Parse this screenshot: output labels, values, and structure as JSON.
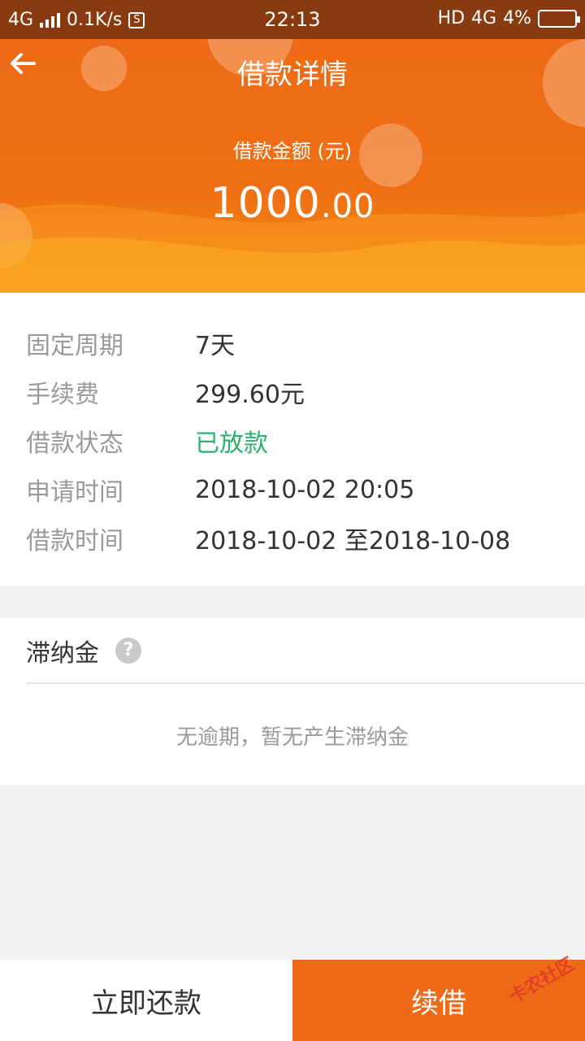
{
  "status_bar": {
    "network": "4G",
    "speed": "0.1K/s",
    "sim_badge": "S",
    "time": "22:13",
    "hd": "HD",
    "network2": "4G",
    "battery": "4%"
  },
  "header": {
    "title": "借款详情",
    "amount_label": "借款金额 (元)",
    "amount_int": "1000",
    "amount_dec": ".00"
  },
  "details": [
    {
      "key": "固定周期",
      "value": "7天"
    },
    {
      "key": "手续费",
      "value": "299.60元"
    },
    {
      "key": "借款状态",
      "value": "已放款"
    },
    {
      "key": "申请时间",
      "value": "2018-10-02 20:05"
    },
    {
      "key": "借款时间",
      "value": "2018-10-02 至2018-10-08"
    }
  ],
  "late_fee": {
    "title": "滞纳金",
    "help_glyph": "?",
    "empty_text": "无逾期，暂无产生滞纳金"
  },
  "actions": {
    "repay": "立即还款",
    "renew": "续借"
  },
  "watermark": "卡农社区",
  "colors": {
    "accent": "#ee6a16",
    "status_green": "#2ab36a"
  },
  "icons": {
    "back": "arrow-left-icon",
    "help": "question-icon"
  }
}
